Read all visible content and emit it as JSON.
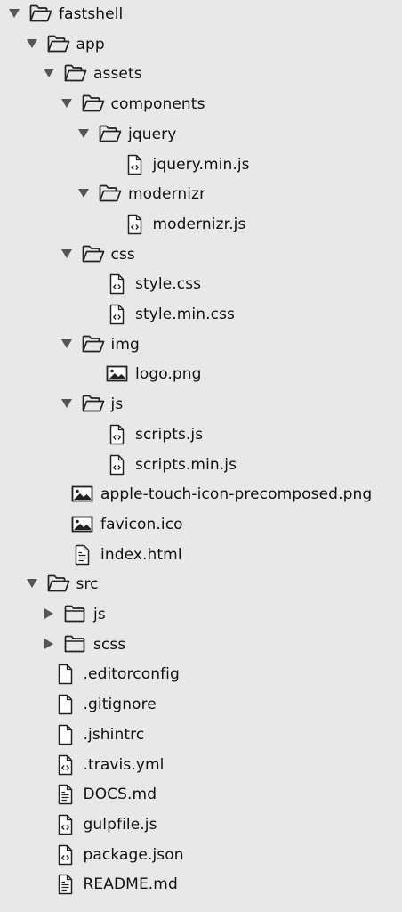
{
  "tree": [
    {
      "label": "fastshell",
      "kind": "folder",
      "expanded": true,
      "depth": 0
    },
    {
      "label": "app",
      "kind": "folder",
      "expanded": true,
      "depth": 1
    },
    {
      "label": "assets",
      "kind": "folder",
      "expanded": true,
      "depth": 2
    },
    {
      "label": "components",
      "kind": "folder",
      "expanded": true,
      "depth": 3
    },
    {
      "label": "jquery",
      "kind": "folder",
      "expanded": true,
      "depth": 4
    },
    {
      "label": "jquery.min.js",
      "kind": "code-file",
      "depth": 5
    },
    {
      "label": "modernizr",
      "kind": "folder",
      "expanded": true,
      "depth": 4
    },
    {
      "label": "modernizr.js",
      "kind": "code-file",
      "depth": 5
    },
    {
      "label": "css",
      "kind": "folder",
      "expanded": true,
      "depth": 3
    },
    {
      "label": "style.css",
      "kind": "code-file",
      "depth": 4
    },
    {
      "label": "style.min.css",
      "kind": "code-file",
      "depth": 4
    },
    {
      "label": "img",
      "kind": "folder",
      "expanded": true,
      "depth": 3
    },
    {
      "label": "logo.png",
      "kind": "image-file",
      "depth": 4
    },
    {
      "label": "js",
      "kind": "folder",
      "expanded": true,
      "depth": 3
    },
    {
      "label": "scripts.js",
      "kind": "code-file",
      "depth": 4
    },
    {
      "label": "scripts.min.js",
      "kind": "code-file",
      "depth": 4
    },
    {
      "label": "apple-touch-icon-precomposed.png",
      "kind": "image-file",
      "depth": 2
    },
    {
      "label": "favicon.ico",
      "kind": "image-file",
      "depth": 2
    },
    {
      "label": "index.html",
      "kind": "text-file",
      "depth": 2
    },
    {
      "label": "src",
      "kind": "folder",
      "expanded": true,
      "depth": 1
    },
    {
      "label": "js",
      "kind": "folder",
      "expanded": false,
      "depth": 2
    },
    {
      "label": "scss",
      "kind": "folder",
      "expanded": false,
      "depth": 2
    },
    {
      "label": ".editorconfig",
      "kind": "blank-file",
      "depth": 1
    },
    {
      "label": ".gitignore",
      "kind": "blank-file",
      "depth": 1
    },
    {
      "label": ".jshintrc",
      "kind": "blank-file",
      "depth": 1
    },
    {
      "label": ".travis.yml",
      "kind": "code-file",
      "depth": 1
    },
    {
      "label": "DOCS.md",
      "kind": "text-file",
      "depth": 1
    },
    {
      "label": "gulpfile.js",
      "kind": "code-file",
      "depth": 1
    },
    {
      "label": "package.json",
      "kind": "code-file",
      "depth": 1
    },
    {
      "label": "README.md",
      "kind": "text-file",
      "depth": 1
    }
  ],
  "icons": {
    "folder": "folder-icon",
    "code-file": "code-file-icon",
    "image-file": "image-file-icon",
    "text-file": "text-file-icon",
    "blank-file": "file-icon",
    "expanded": "disclosure-expanded-icon",
    "collapsed": "disclosure-collapsed-icon"
  },
  "colors": {
    "background": "#e8e8e8",
    "text": "#111111",
    "icon_stroke": "#222222",
    "arrow": "#555555"
  }
}
